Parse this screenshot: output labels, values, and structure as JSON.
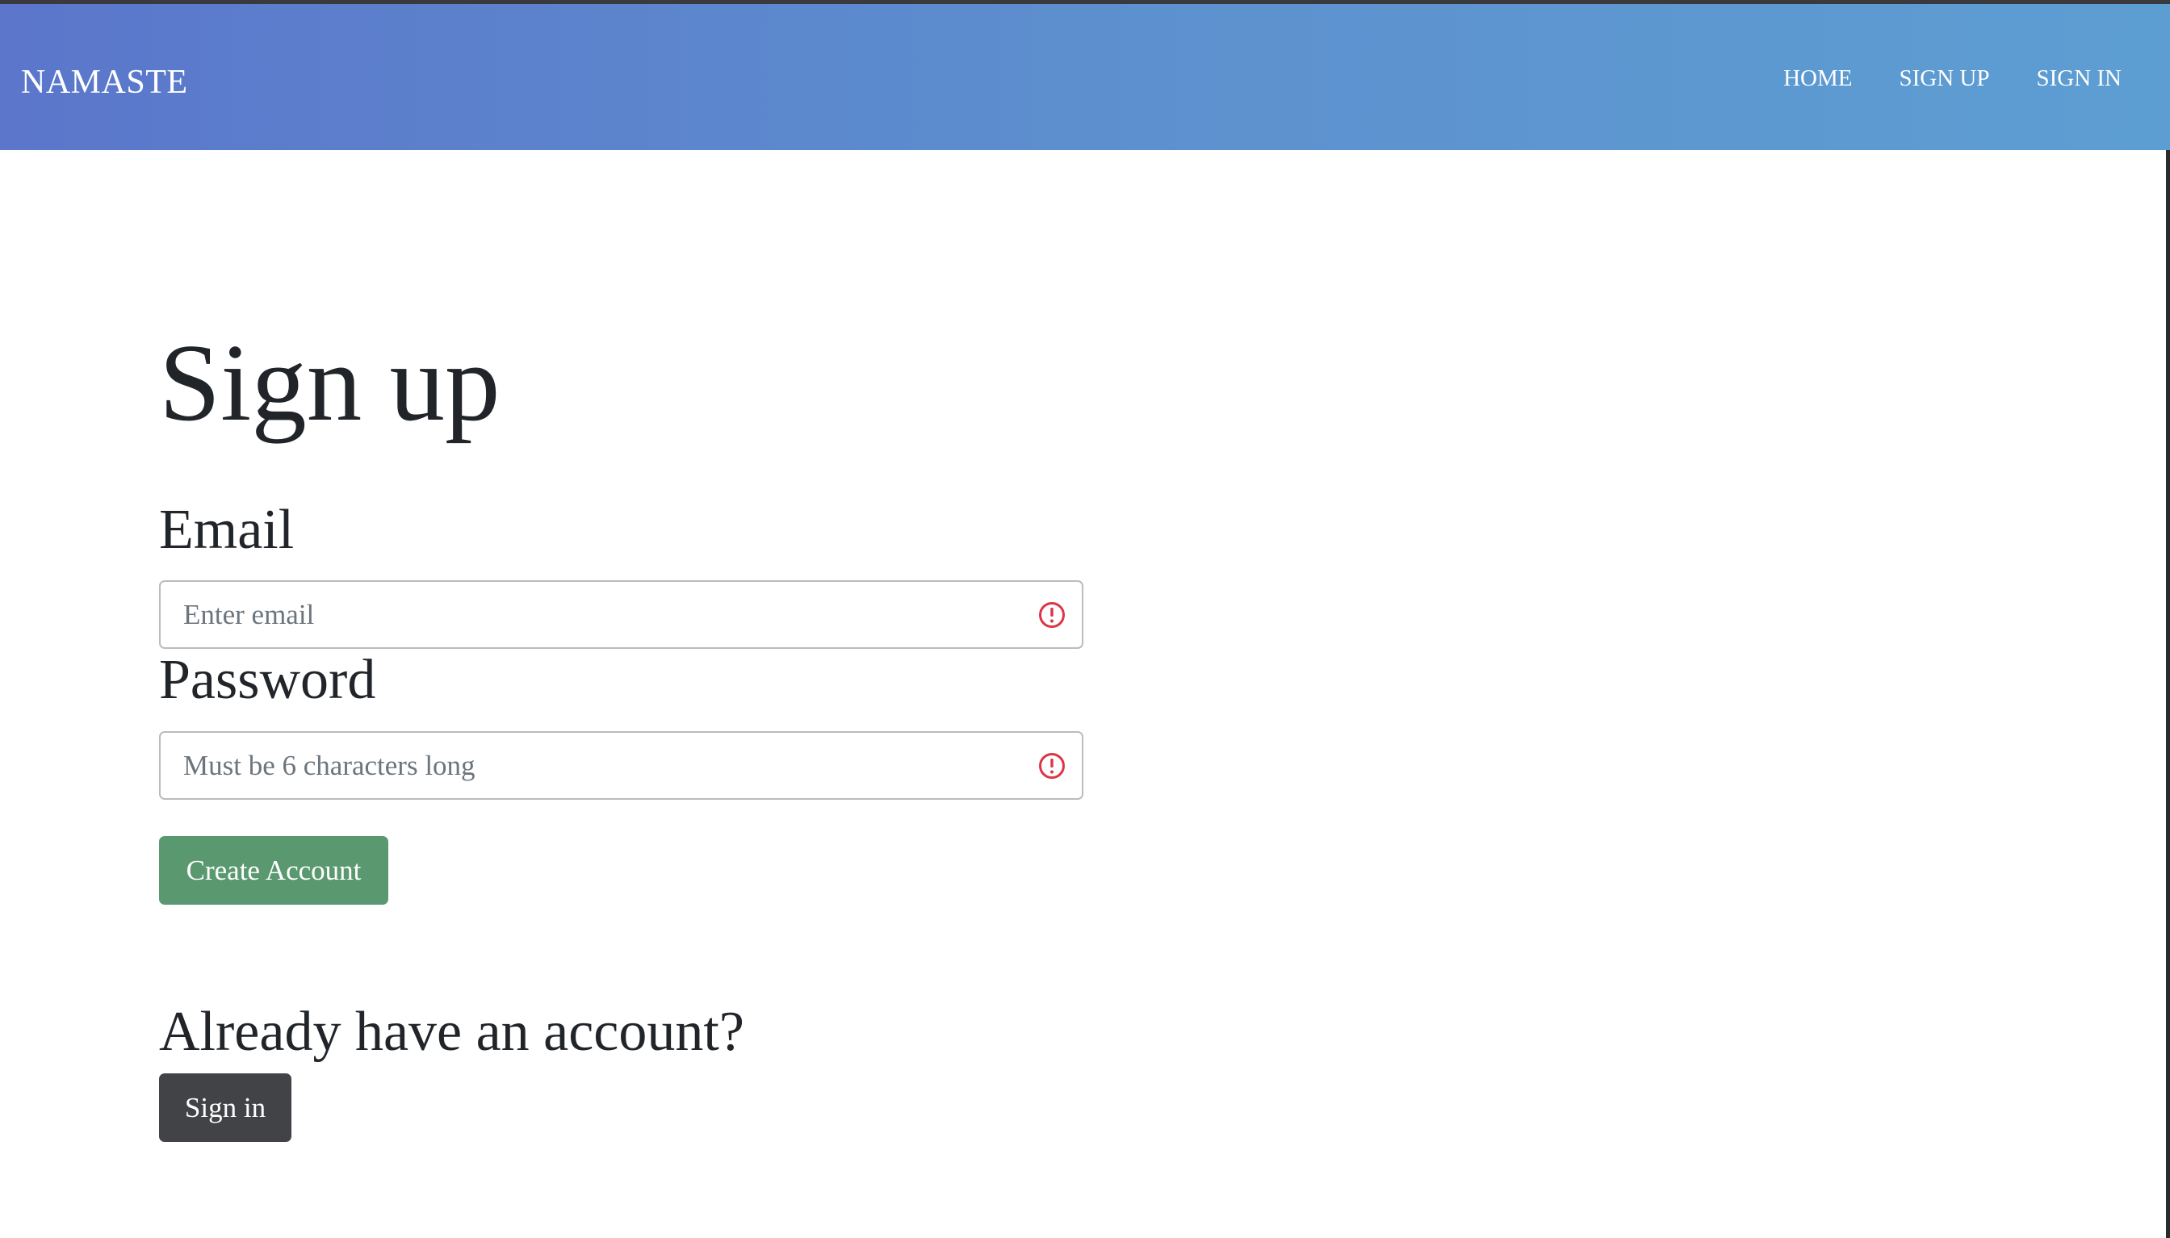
{
  "navbar": {
    "brand": "NAMASTE",
    "links": [
      {
        "label": "HOME"
      },
      {
        "label": "SIGN UP"
      },
      {
        "label": "SIGN IN"
      }
    ]
  },
  "form": {
    "title": "Sign up",
    "email": {
      "label": "Email",
      "value": "",
      "placeholder": "Enter email",
      "status_icon": "exclamation-circle-icon"
    },
    "password": {
      "label": "Password",
      "value": "",
      "placeholder": "Must be 6 characters long",
      "status_icon": "exclamation-circle-icon"
    },
    "submit_label": "Create Account"
  },
  "signin_section": {
    "prompt": "Already have an account?",
    "button_label": "Sign in"
  },
  "colors": {
    "navbar_gradient_start": "#5b76cb",
    "navbar_gradient_end": "#5d9ed2",
    "create_button": "#5a9970",
    "signin_button": "#414346",
    "invalid_icon": "#dc3545"
  }
}
